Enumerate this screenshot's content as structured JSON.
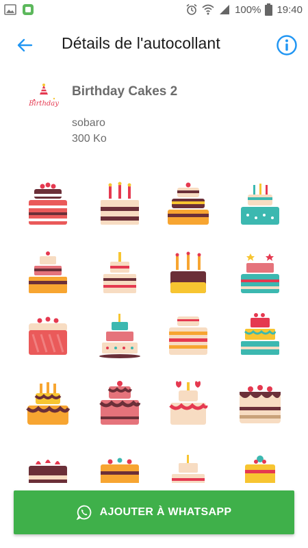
{
  "status_bar": {
    "battery_percent": "100%",
    "time": "19:40"
  },
  "toolbar": {
    "title": "Détails de l'autocollant"
  },
  "pack": {
    "tray_text": "Birthday",
    "name": "Birthday Cakes 2",
    "publisher": "sobaro",
    "size": "300 Ko"
  },
  "colors": {
    "accent": "#2196f3",
    "button": "#3fb04a",
    "button_text": "#ffffff"
  },
  "stickers": [
    "cake-sticker-1",
    "cake-sticker-2",
    "cake-sticker-3",
    "cake-sticker-4",
    "cake-sticker-5",
    "cake-sticker-6",
    "cake-sticker-7",
    "cake-sticker-8",
    "cake-sticker-9",
    "cake-sticker-10",
    "cake-sticker-11",
    "cake-sticker-12",
    "cake-sticker-13",
    "cake-sticker-14",
    "cake-sticker-15",
    "cake-sticker-16",
    "cake-sticker-17",
    "cake-sticker-18",
    "cake-sticker-19",
    "cake-sticker-20"
  ],
  "action": {
    "add_label": "AJOUTER À WHATSAPP"
  }
}
